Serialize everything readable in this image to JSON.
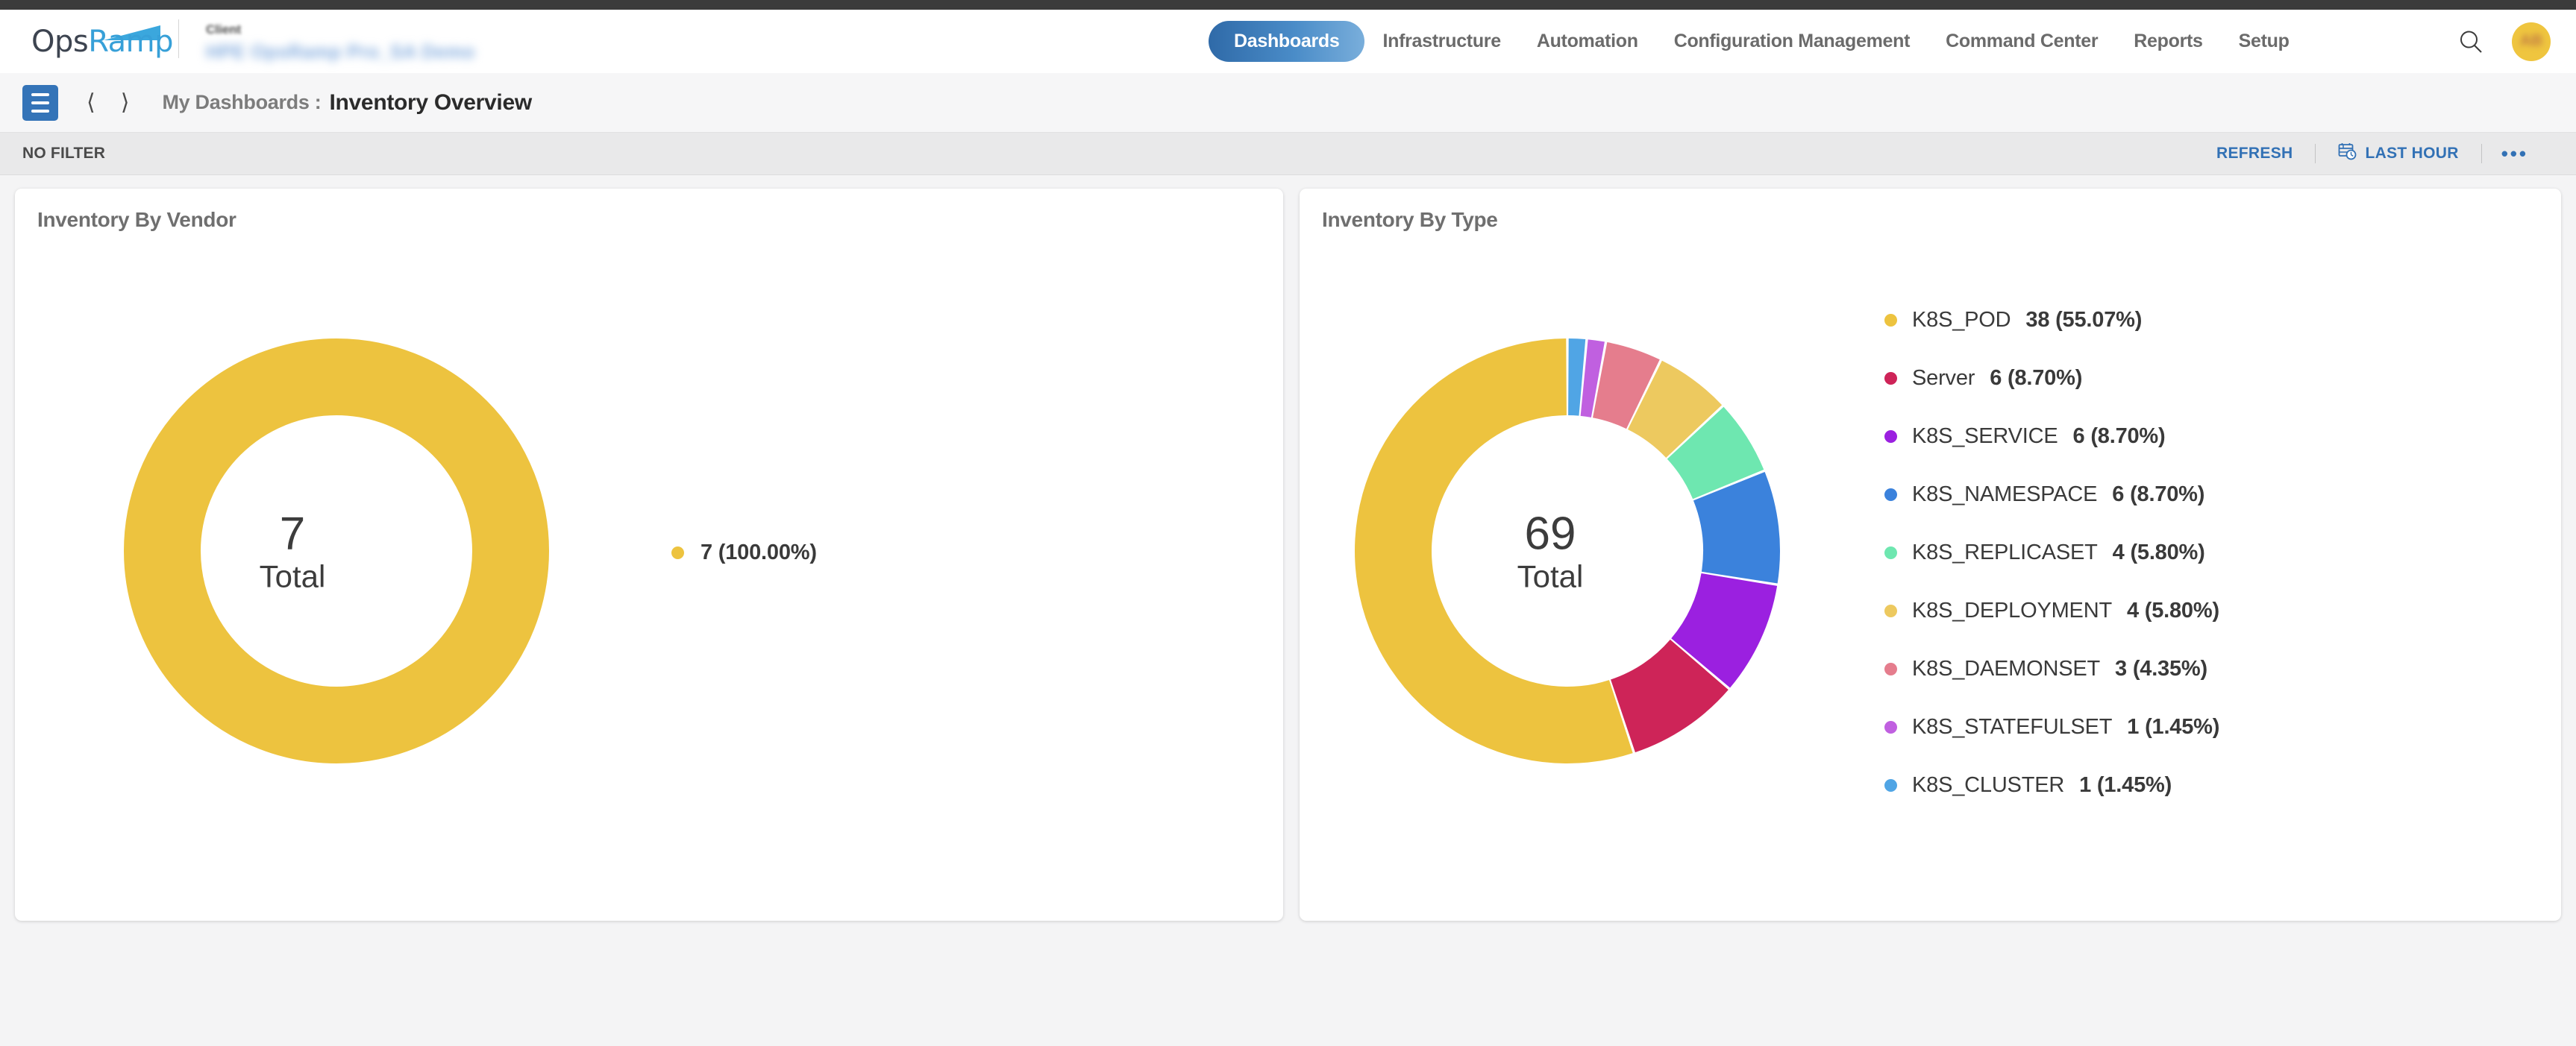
{
  "header": {
    "logo": {
      "part1": "Ops",
      "part2": "Ramp"
    },
    "client_label": "Client",
    "client_name": "HPE OpsRamp Pro_SA Demo",
    "avatar_initials": "AB",
    "search_icon": "search-icon",
    "nav_items": [
      {
        "label": "Dashboards",
        "active": true
      },
      {
        "label": "Infrastructure",
        "active": false
      },
      {
        "label": "Automation",
        "active": false
      },
      {
        "label": "Configuration Management",
        "active": false
      },
      {
        "label": "Command Center",
        "active": false
      },
      {
        "label": "Reports",
        "active": false
      },
      {
        "label": "Setup",
        "active": false
      }
    ]
  },
  "breadcrumb": {
    "menu_icon": "hamburger-menu-icon",
    "prev_icon": "chevron-left-icon",
    "next_icon": "chevron-right-icon",
    "parent": "My Dashboards :",
    "current": "Inventory Overview"
  },
  "filter_bar": {
    "status": "NO FILTER",
    "refresh_label": "REFRESH",
    "time_range_label": "LAST HOUR",
    "time_range_icon": "calendar-clock-icon",
    "more_label": "•••",
    "accent_color": "#3271b5"
  },
  "cards": [
    {
      "id": "inventory-by-vendor",
      "title": "Inventory By Vendor",
      "total": "7",
      "total_label": "Total"
    },
    {
      "id": "inventory-by-type",
      "title": "Inventory By Type",
      "total": "69",
      "total_label": "Total"
    }
  ],
  "chart_data": [
    {
      "type": "pie",
      "title": "Inventory By Vendor",
      "variant": "donut",
      "center_value": 7,
      "center_label": "Total",
      "total": 7,
      "legend_position": "right",
      "categories": [
        ""
      ],
      "values": [
        7
      ],
      "percentages": [
        100.0
      ],
      "labels": [
        "7 (100.00%)"
      ],
      "colors": [
        "#edc33f"
      ]
    },
    {
      "type": "pie",
      "title": "Inventory By Type",
      "variant": "donut",
      "center_value": 69,
      "center_label": "Total",
      "total": 69,
      "legend_position": "right",
      "categories": [
        "K8S_POD",
        "Server",
        "K8S_SERVICE",
        "K8S_NAMESPACE",
        "K8S_REPLICASET",
        "K8S_DEPLOYMENT",
        "K8S_DAEMONSET",
        "K8S_STATEFULSET",
        "K8S_CLUSTER"
      ],
      "values": [
        38,
        6,
        6,
        6,
        4,
        4,
        3,
        1,
        1
      ],
      "percentages": [
        55.07,
        8.7,
        8.7,
        8.7,
        5.8,
        5.8,
        4.35,
        1.45,
        1.45
      ],
      "labels": [
        "38 (55.07%)",
        "6 (8.70%)",
        "6 (8.70%)",
        "6 (8.70%)",
        "4 (5.80%)",
        "4 (5.80%)",
        "3 (4.35%)",
        "1 (1.45%)",
        "1 (1.45%)"
      ],
      "colors": [
        "#edc33f",
        "#ce2458",
        "#9b20e0",
        "#3b82dc",
        "#6ee7b0",
        "#edc95f",
        "#e57d8d",
        "#c060e0",
        "#50a5e5"
      ]
    }
  ]
}
